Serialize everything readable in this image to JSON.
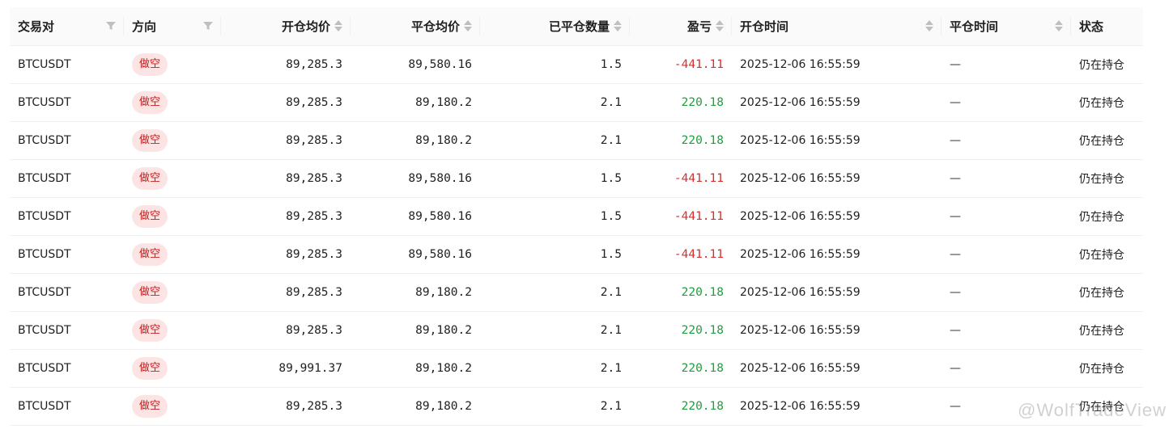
{
  "columns": {
    "pair": "交易对",
    "direction": "方向",
    "open_avg": "开仓均价",
    "close_avg": "平仓均价",
    "closed_qty": "已平仓数量",
    "pnl": "盈亏",
    "open_time": "开仓时间",
    "close_time": "平仓时间",
    "status": "状态"
  },
  "rows": [
    {
      "pair": "BTCUSDT",
      "direction": "做空",
      "open_avg": "89,285.3",
      "close_avg": "89,580.16",
      "closed_qty": "1.5",
      "pnl": "-441.11",
      "pnl_sign": "neg",
      "open_time": "2025-12-06 16:55:59",
      "close_time": "—",
      "status": "仍在持仓"
    },
    {
      "pair": "BTCUSDT",
      "direction": "做空",
      "open_avg": "89,285.3",
      "close_avg": "89,180.2",
      "closed_qty": "2.1",
      "pnl": "220.18",
      "pnl_sign": "pos",
      "open_time": "2025-12-06 16:55:59",
      "close_time": "—",
      "status": "仍在持仓"
    },
    {
      "pair": "BTCUSDT",
      "direction": "做空",
      "open_avg": "89,285.3",
      "close_avg": "89,180.2",
      "closed_qty": "2.1",
      "pnl": "220.18",
      "pnl_sign": "pos",
      "open_time": "2025-12-06 16:55:59",
      "close_time": "—",
      "status": "仍在持仓"
    },
    {
      "pair": "BTCUSDT",
      "direction": "做空",
      "open_avg": "89,285.3",
      "close_avg": "89,580.16",
      "closed_qty": "1.5",
      "pnl": "-441.11",
      "pnl_sign": "neg",
      "open_time": "2025-12-06 16:55:59",
      "close_time": "—",
      "status": "仍在持仓"
    },
    {
      "pair": "BTCUSDT",
      "direction": "做空",
      "open_avg": "89,285.3",
      "close_avg": "89,580.16",
      "closed_qty": "1.5",
      "pnl": "-441.11",
      "pnl_sign": "neg",
      "open_time": "2025-12-06 16:55:59",
      "close_time": "—",
      "status": "仍在持仓"
    },
    {
      "pair": "BTCUSDT",
      "direction": "做空",
      "open_avg": "89,285.3",
      "close_avg": "89,580.16",
      "closed_qty": "1.5",
      "pnl": "-441.11",
      "pnl_sign": "neg",
      "open_time": "2025-12-06 16:55:59",
      "close_time": "—",
      "status": "仍在持仓"
    },
    {
      "pair": "BTCUSDT",
      "direction": "做空",
      "open_avg": "89,285.3",
      "close_avg": "89,180.2",
      "closed_qty": "2.1",
      "pnl": "220.18",
      "pnl_sign": "pos",
      "open_time": "2025-12-06 16:55:59",
      "close_time": "—",
      "status": "仍在持仓"
    },
    {
      "pair": "BTCUSDT",
      "direction": "做空",
      "open_avg": "89,285.3",
      "close_avg": "89,180.2",
      "closed_qty": "2.1",
      "pnl": "220.18",
      "pnl_sign": "pos",
      "open_time": "2025-12-06 16:55:59",
      "close_time": "—",
      "status": "仍在持仓"
    },
    {
      "pair": "BTCUSDT",
      "direction": "做空",
      "open_avg": "89,991.37",
      "close_avg": "89,180.2",
      "closed_qty": "2.1",
      "pnl": "220.18",
      "pnl_sign": "pos",
      "open_time": "2025-12-06 16:55:59",
      "close_time": "—",
      "status": "仍在持仓"
    },
    {
      "pair": "BTCUSDT",
      "direction": "做空",
      "open_avg": "89,285.3",
      "close_avg": "89,180.2",
      "closed_qty": "2.1",
      "pnl": "220.18",
      "pnl_sign": "pos",
      "open_time": "2025-12-06 16:55:59",
      "close_time": "—",
      "status": "仍在持仓"
    }
  ],
  "icons": {
    "sort": "sort-icon",
    "filter": "filter-icon"
  },
  "colors": {
    "badge_bg": "#fde4e4",
    "badge_text": "#c21c1c",
    "negative": "#d32f2f",
    "positive": "#1e9e3c"
  },
  "watermark": "@WolfTradeView"
}
